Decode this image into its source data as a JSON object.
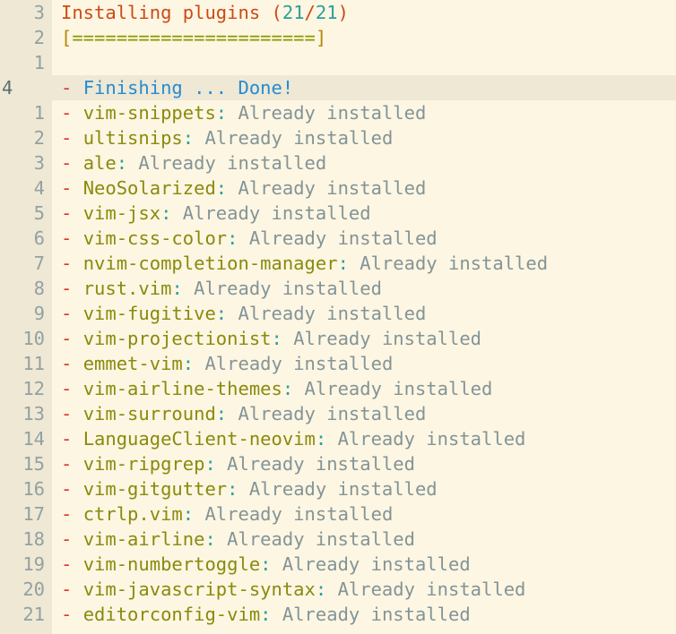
{
  "terminal": {
    "app": "neovim",
    "theme": "NeoSolarized-light",
    "background": "#fdf6e3",
    "gutter_background": "#eee8d5",
    "cursorline_background": "#eee8d5"
  },
  "colors": {
    "orange": "#cb4b16",
    "cyan": "#2aa198",
    "red": "#dc322f",
    "blue": "#268bd2",
    "olive": "#8a8a0c",
    "grey": "#839496",
    "linenr": "#93a1a1",
    "cursor_linenr": "#586e75",
    "bar_bracket": "#b58900",
    "bar_fill": "#859900"
  },
  "header": {
    "line_number": "3",
    "title": "Installing plugins",
    "open_paren": "(",
    "done_count": "21",
    "slash": "/",
    "total_count": "21",
    "close_paren": ")"
  },
  "progress": {
    "line_number": "2",
    "left_bracket": "[",
    "fill": "======================",
    "right_bracket": "]",
    "filled_segments": 22,
    "total_segments": 22,
    "percent": "100"
  },
  "blank_line": {
    "line_number": "1",
    "text": ""
  },
  "status": {
    "line_number": "4",
    "bullet": "-",
    "label": "Finishing ... Done!",
    "is_cursor_line": true
  },
  "plugin_status_text": "Already installed",
  "plugins": [
    {
      "line_number": "1",
      "bullet": "-",
      "name": "vim-snippets",
      "colon": ":",
      "status": "Already installed"
    },
    {
      "line_number": "2",
      "bullet": "-",
      "name": "ultisnips",
      "colon": ":",
      "status": "Already installed"
    },
    {
      "line_number": "3",
      "bullet": "-",
      "name": "ale",
      "colon": ":",
      "status": "Already installed"
    },
    {
      "line_number": "4",
      "bullet": "-",
      "name": "NeoSolarized",
      "colon": ":",
      "status": "Already installed"
    },
    {
      "line_number": "5",
      "bullet": "-",
      "name": "vim-jsx",
      "colon": ":",
      "status": "Already installed"
    },
    {
      "line_number": "6",
      "bullet": "-",
      "name": "vim-css-color",
      "colon": ":",
      "status": "Already installed"
    },
    {
      "line_number": "7",
      "bullet": "-",
      "name": "nvim-completion-manager",
      "colon": ":",
      "status": "Already installed"
    },
    {
      "line_number": "8",
      "bullet": "-",
      "name": "rust.vim",
      "colon": ":",
      "status": "Already installed"
    },
    {
      "line_number": "9",
      "bullet": "-",
      "name": "vim-fugitive",
      "colon": ":",
      "status": "Already installed"
    },
    {
      "line_number": "10",
      "bullet": "-",
      "name": "vim-projectionist",
      "colon": ":",
      "status": "Already installed"
    },
    {
      "line_number": "11",
      "bullet": "-",
      "name": "emmet-vim",
      "colon": ":",
      "status": "Already installed"
    },
    {
      "line_number": "12",
      "bullet": "-",
      "name": "vim-airline-themes",
      "colon": ":",
      "status": "Already installed"
    },
    {
      "line_number": "13",
      "bullet": "-",
      "name": "vim-surround",
      "colon": ":",
      "status": "Already installed"
    },
    {
      "line_number": "14",
      "bullet": "-",
      "name": "LanguageClient-neovim",
      "colon": ":",
      "status": "Already installed"
    },
    {
      "line_number": "15",
      "bullet": "-",
      "name": "vim-ripgrep",
      "colon": ":",
      "status": "Already installed"
    },
    {
      "line_number": "16",
      "bullet": "-",
      "name": "vim-gitgutter",
      "colon": ":",
      "status": "Already installed"
    },
    {
      "line_number": "17",
      "bullet": "-",
      "name": "ctrlp.vim",
      "colon": ":",
      "status": "Already installed"
    },
    {
      "line_number": "18",
      "bullet": "-",
      "name": "vim-airline",
      "colon": ":",
      "status": "Already installed"
    },
    {
      "line_number": "19",
      "bullet": "-",
      "name": "vim-numbertoggle",
      "colon": ":",
      "status": "Already installed"
    },
    {
      "line_number": "20",
      "bullet": "-",
      "name": "vim-javascript-syntax",
      "colon": ":",
      "status": "Already installed"
    },
    {
      "line_number": "21",
      "bullet": "-",
      "name": "editorconfig-vim",
      "colon": ":",
      "status": "Already installed"
    }
  ]
}
